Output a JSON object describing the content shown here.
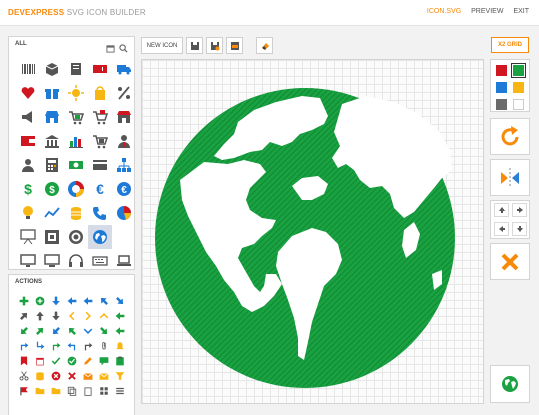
{
  "header": {
    "brand_primary": "DEVEXPRESS",
    "brand_secondary": "SVG ICON BUILDER",
    "nav": [
      "ICON.SVG",
      "PREVIEW",
      "EXIT"
    ]
  },
  "library": {
    "title": "ALL",
    "icons": [
      "barcode-icon",
      "box-icon",
      "printer-icon",
      "ticket-icon",
      "truck-icon",
      "heart-icon",
      "gift-icon",
      "sun-icon",
      "shopping-bag-icon",
      "percent-icon",
      "megaphone-icon",
      "shop-icon",
      "cart-in-icon",
      "cart-out-icon",
      "store-icon",
      "wallet-icon",
      "bank-icon",
      "bar-chart-icon",
      "cart-add-icon",
      "user-icon",
      "businessman-icon",
      "calculator-icon",
      "banknote-icon",
      "credit-card-icon",
      "hierarchy-icon",
      "dollar-icon",
      "dollar-circle-icon",
      "donut-chart-icon",
      "euro-icon",
      "euro-circle-icon",
      "lightbulb-icon",
      "line-chart-icon",
      "coins-icon",
      "phone-icon",
      "pie-chart-icon",
      "presentation-icon",
      "frame-icon",
      "target-icon",
      "globe-icon",
      "",
      "monitor-icon",
      "display-icon",
      "headphones-icon",
      "keyboard-icon",
      "laptop-icon"
    ]
  },
  "actions": {
    "title": "ACTIONS"
  },
  "toolbar": {
    "new_icon_label": "NEW ICON"
  },
  "right": {
    "grid_label": "X2 GRID"
  },
  "colors": {
    "swatches": [
      "#d0171f",
      "#1aa141",
      "#1e7ad7",
      "#f7b612",
      "#6b6b6b",
      "#ffffff"
    ],
    "selected": "#1aa141"
  }
}
